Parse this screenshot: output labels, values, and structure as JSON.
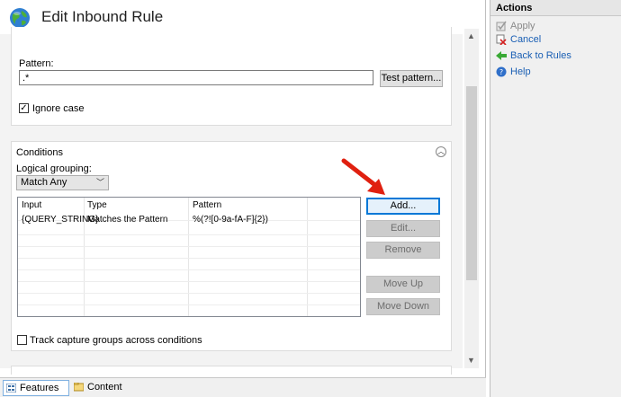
{
  "header": {
    "title": "Edit Inbound Rule"
  },
  "pattern_section": {
    "pattern_label": "Pattern:",
    "pattern_value": ".*",
    "test_button": "Test pattern...",
    "ignore_case_label": "Ignore case",
    "ignore_case_checked": true
  },
  "conditions": {
    "title": "Conditions",
    "logical_grouping_label": "Logical grouping:",
    "logical_grouping_value": "Match Any",
    "columns": [
      "Input",
      "Type",
      "Pattern"
    ],
    "rows": [
      {
        "input": "{QUERY_STRING}",
        "type": "Matches the Pattern",
        "pattern": "%(?![0-9a-fA-F]{2})"
      }
    ],
    "buttons": {
      "add": "Add...",
      "edit": "Edit...",
      "remove": "Remove",
      "move_up": "Move Up",
      "move_down": "Move Down"
    },
    "track_label": "Track capture groups across conditions",
    "track_checked": false
  },
  "footer": {
    "features_view": "Features View",
    "content_view": "Content View"
  },
  "actions": {
    "title": "Actions",
    "apply": "Apply",
    "cancel": "Cancel",
    "back_to_rules": "Back to Rules",
    "help": "Help"
  },
  "colors": {
    "accent": "#0078d7",
    "arrow": "#e02010",
    "link": "#1a5fb4"
  }
}
